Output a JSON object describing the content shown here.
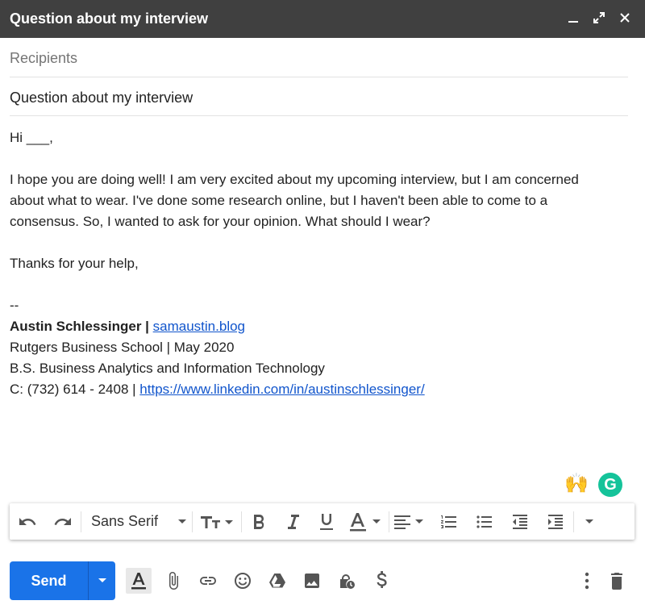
{
  "window": {
    "title": "Question about my interview"
  },
  "compose": {
    "recipients_placeholder": "Recipients",
    "subject": "Question about my interview"
  },
  "body": {
    "greeting": "Hi ___,",
    "paragraph_line1": "I hope you are doing well! I am very excited about my upcoming interview, but I am concerned",
    "paragraph_line2": "about what to wear. I've done some research online, but I haven't been able to come to a",
    "paragraph_line3": "consensus. So, I wanted to ask for your opinion. What should I wear?",
    "closing": "Thanks for your help,",
    "sig_separator": "--",
    "sig_name": "Austin Schlessinger |",
    "sig_blog": "samaustin.blog",
    "sig_school": "Rutgers Business School | May 2020",
    "sig_degree": "B.S. Business Analytics and Information Technology",
    "sig_phone": "C: (732) 614 - 2408 |",
    "sig_linkedin": "https://www.linkedin.com/in/austinschlessinger/"
  },
  "addons": {
    "emoji": "🙌",
    "grammarly_letter": "G"
  },
  "toolbar": {
    "font": "Sans Serif"
  },
  "footer": {
    "send_label": "Send"
  },
  "colors": {
    "accent": "#1a73e8",
    "titlebar": "#404040",
    "link": "#1155cc",
    "grammarly": "#15c39a"
  },
  "icons": [
    "minimize-icon",
    "expand-icon",
    "close-icon",
    "undo-icon",
    "redo-icon",
    "text-size-icon",
    "bold-icon",
    "italic-icon",
    "underline-icon",
    "text-color-icon",
    "align-icon",
    "numbered-list-icon",
    "bulleted-list-icon",
    "indent-less-icon",
    "indent-more-icon",
    "more-formatting-icon",
    "formatting-options-icon",
    "attach-icon",
    "link-icon",
    "emoji-icon",
    "drive-icon",
    "photo-icon",
    "confidential-icon",
    "money-icon",
    "more-options-icon",
    "trash-icon"
  ]
}
